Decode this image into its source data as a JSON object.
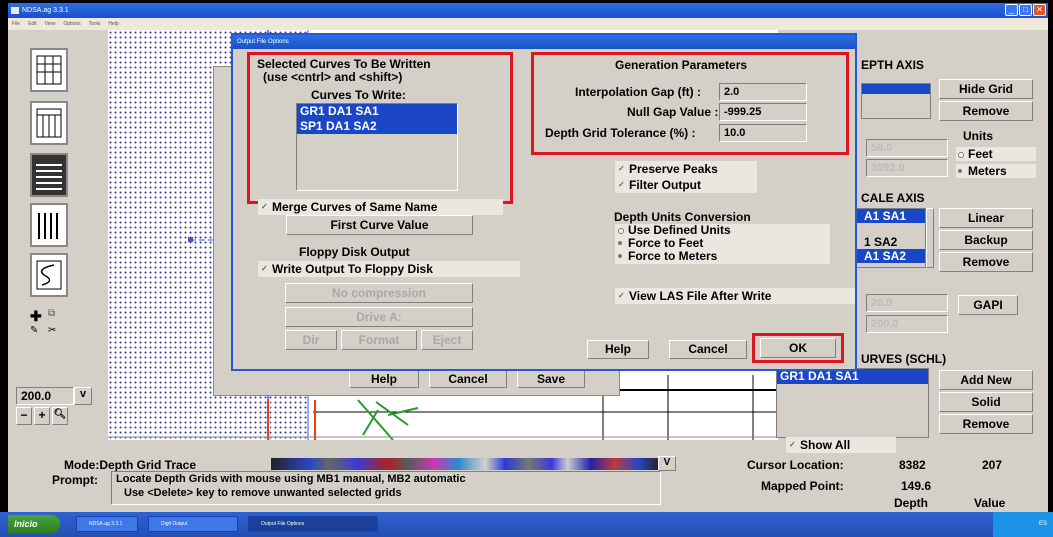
{
  "app": {
    "title": "NDSA.ag 3.3.1",
    "menu": [
      "File",
      "Edit",
      "View",
      "Options",
      "Tools",
      "Help"
    ]
  },
  "dialog": {
    "title": "Output File Options",
    "selected_curves": {
      "heading": "Selected Curves To Be Written",
      "hint": "(use <cntrl> and <shift>)",
      "list_label": "Curves To Write:",
      "items": [
        "GR1 DA1 SA1",
        "SP1 DA1 SA2"
      ]
    },
    "merge_label": "Merge Curves of Same Name",
    "first_curve_value": "First Curve Value",
    "floppy": {
      "heading": "Floppy Disk Output",
      "write_label": "Write Output To Floppy Disk",
      "compression": "No compression",
      "drive": "Drive A:",
      "dir": "Dir",
      "format": "Format",
      "eject": "Eject"
    },
    "generation": {
      "heading": "Generation Parameters",
      "interp_label": "Interpolation Gap (ft) :",
      "interp_value": "2.0",
      "null_label": "Null Gap Value :",
      "null_value": "-999.25",
      "tol_label": "Depth Grid Tolerance (%) :",
      "tol_value": "10.0"
    },
    "preserve_peaks": "Preserve Peaks",
    "filter_output": "Filter Output",
    "depth_units": {
      "heading": "Depth Units Conversion",
      "options": [
        "Use Defined Units",
        "Force to Feet",
        "Force to Meters"
      ]
    },
    "view_las": "View LAS File After Write",
    "help": "Help",
    "cancel": "Cancel",
    "ok": "OK"
  },
  "under_dialog": {
    "help": "Help",
    "cancel": "Cancel",
    "save": "Save"
  },
  "right_panel": {
    "depth_axis_label": "EPTH AXIS",
    "hide_grid": "Hide Grid",
    "remove": "Remove",
    "units_label": "Units",
    "feet": "Feet",
    "meters": "Meters",
    "top_value": "58.0",
    "bottom_value": "3092.0",
    "scale_axis_label": "CALE AXIS",
    "scale_items": [
      "A1 SA1",
      "1 SA2",
      "A1 SA2"
    ],
    "linear": "Linear",
    "backup": "Backup",
    "remove2": "Remove",
    "min_value": "20.0",
    "max_value": "200.0",
    "gapi": "GAPI",
    "curves_label": "URVES (SCHL)",
    "curve_item": "GR1 DA1 SA1",
    "add_new": "Add New",
    "solid": "Solid",
    "remove3": "Remove",
    "show_all": "Show All"
  },
  "left_panel": {
    "zoom_value": "200.0",
    "zoom_dropdown": "v"
  },
  "status": {
    "mode": "Mode:Depth Grid Trace",
    "v": "V",
    "prompt_label": "Prompt:",
    "prompt_line1": "Locate Depth Grids with mouse using MB1 manual, MB2 automatic",
    "prompt_line2": "Use <Delete> key to remove unwanted selected grids",
    "cursor_label": "Cursor Location:",
    "cursor_x": "8382",
    "cursor_y": "207",
    "mapped_label": "Mapped Point:",
    "mapped_value": "149.6",
    "depth_label": "Depth",
    "value_label": "Value"
  },
  "taskbar": {
    "start": "Inicio",
    "tasks": [
      "NDSA.ag 3.3.1",
      "Digit Output",
      "Output File Options"
    ],
    "tray": "ES"
  },
  "colors": {
    "highlight": "#e0161e",
    "selection": "#1b46c8",
    "title_blue": "#1a4fc9"
  }
}
